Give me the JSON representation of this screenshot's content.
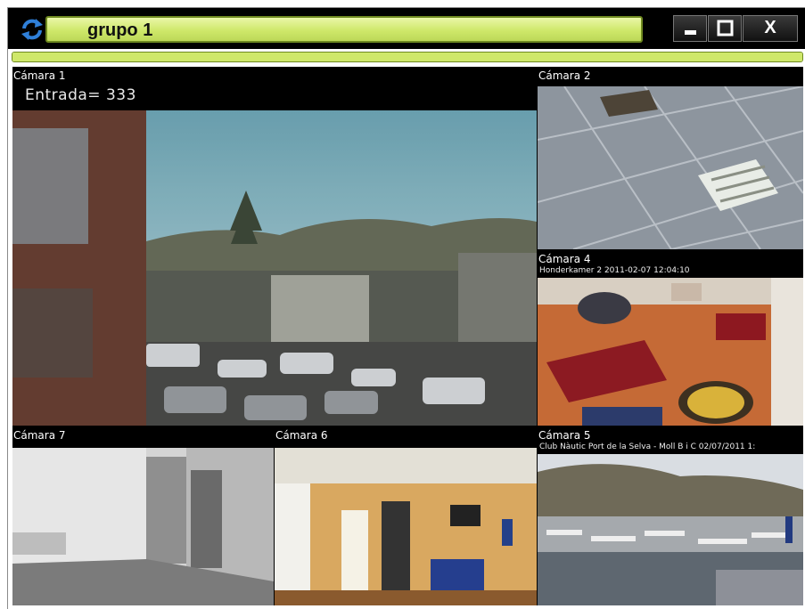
{
  "window": {
    "title": "grupo 1",
    "close_label": "X",
    "progress_fraction": 1.0
  },
  "colors": {
    "title_field": "#cfe86a",
    "title_border": "#6f8a20",
    "refresh_icon": "#2f7fd8"
  },
  "cameras": [
    {
      "id": "cam1",
      "label": "Cámara 1",
      "overlay": "Entrada= 333"
    },
    {
      "id": "cam2",
      "label": "Cámara 2"
    },
    {
      "id": "cam4",
      "label": "Cámara 4",
      "stamp": "Honderkamer 2 2011-02-07 12:04:10"
    },
    {
      "id": "cam7",
      "label": "Cámara 7"
    },
    {
      "id": "cam6",
      "label": "Cámara 6"
    },
    {
      "id": "cam5",
      "label": "Cámara 5",
      "stamp": "Club Nàutic Port de la Selva - Moll B i C 02/07/2011 1:"
    }
  ]
}
